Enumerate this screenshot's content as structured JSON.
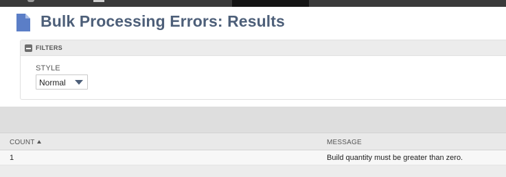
{
  "page": {
    "title": "Bulk Processing Errors: Results",
    "icon": "document-icon"
  },
  "filters": {
    "section_label": "FILTERS",
    "style_label": "STYLE",
    "style_value": "Normal"
  },
  "table": {
    "columns": [
      "COUNT",
      "MESSAGE"
    ],
    "sort": {
      "column": "COUNT",
      "direction": "ascending"
    },
    "rows": [
      {
        "count": "1",
        "message": "Build quantity must be greater than zero."
      }
    ]
  },
  "colors": {
    "title": "#4d5f79",
    "accent": "#4d5f79",
    "topbar": "#3a3a3a"
  }
}
